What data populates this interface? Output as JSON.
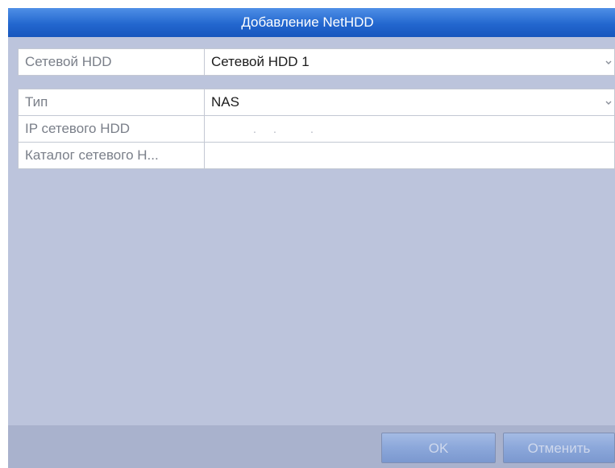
{
  "dialog": {
    "title": "Добавление NetHDD"
  },
  "fields": {
    "nethdd": {
      "label": "Сетевой HDD",
      "value": "Сетевой HDD 1"
    },
    "type": {
      "label": "Тип",
      "value": "NAS"
    },
    "ip": {
      "label": "IP сетевого HDD",
      "value": ". . ."
    },
    "directory": {
      "label": "Каталог сетевого H...",
      "value": ""
    }
  },
  "buttons": {
    "ok_label": "OK",
    "cancel_label": "Отменить"
  },
  "icons": {
    "dropdown": "chevron-down-icon"
  },
  "colors": {
    "titlebar": "#2367cf",
    "background": "#bcc4dc",
    "button": "#8ba7da",
    "button_text": "#cfd8ec"
  }
}
